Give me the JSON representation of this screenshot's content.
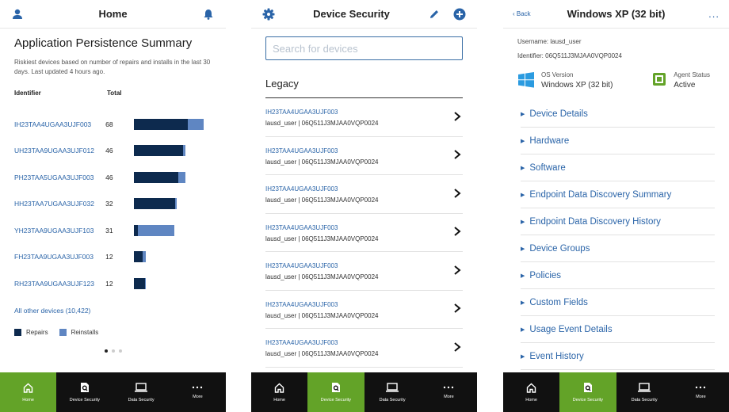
{
  "colors": {
    "accent_green": "#63a328",
    "nav_bg": "#111111",
    "link_blue": "#2a64a8",
    "repairs": "#0d2a4e",
    "reinstalls": "#5f86c2"
  },
  "nav": [
    {
      "label": "Home",
      "icon": "home-icon"
    },
    {
      "label": "Device Security",
      "icon": "device-security-icon"
    },
    {
      "label": "Data Security",
      "icon": "laptop-icon"
    },
    {
      "label": "More",
      "icon": "more-icon"
    }
  ],
  "home": {
    "title": "Home",
    "heading": "Application Persistence Summary",
    "description": "Riskiest devices based on number of repairs and installs in the last 30 days. Last updated 4 hours ago.",
    "col_identifier": "Identifier",
    "col_total": "Total",
    "rows": [
      {
        "id": "IH23TAA4UGAA3UJF003",
        "total": "68",
        "repairs": 68,
        "reinstalls": 20
      },
      {
        "id": "UH23TAA9UGAA3UJF012",
        "total": "46",
        "repairs": 62,
        "reinstalls": 3
      },
      {
        "id": "PH23TAA5UGAA3UJF003",
        "total": "46",
        "repairs": 56,
        "reinstalls": 9
      },
      {
        "id": "HH23TAA7UGAA3UJF032",
        "total": "32",
        "repairs": 52,
        "reinstalls": 2
      },
      {
        "id": "YH23TAA9UGAA3UJF103",
        "total": "31",
        "repairs": 5,
        "reinstalls": 46
      },
      {
        "id": "FH23TAA9UGAA3UJF003",
        "total": "12",
        "repairs": 11,
        "reinstalls": 4
      },
      {
        "id": "RH23TAA9UGAA3UJF123",
        "total": "12",
        "repairs": 14,
        "reinstalls": 1
      }
    ],
    "all_other": "All other devices (10,422)",
    "legend_repairs": "Repairs",
    "legend_reinstalls": "Reinstalls"
  },
  "device_security": {
    "title": "Device Security",
    "search_placeholder": "Search for devices",
    "section": "Legacy",
    "devices": [
      {
        "id": "IH23TAA4UGAA3UJF003",
        "meta": "lausd_user | 06Q511J3MJAA0VQP0024"
      },
      {
        "id": "IH23TAA4UGAA3UJF003",
        "meta": "lausd_user | 06Q511J3MJAA0VQP0024"
      },
      {
        "id": "IH23TAA4UGAA3UJF003",
        "meta": "lausd_user | 06Q511J3MJAA0VQP0024"
      },
      {
        "id": "IH23TAA4UGAA3UJF003",
        "meta": "lausd_user | 06Q511J3MJAA0VQP0024"
      },
      {
        "id": "IH23TAA4UGAA3UJF003",
        "meta": "lausd_user | 06Q511J3MJAA0VQP0024"
      },
      {
        "id": "IH23TAA4UGAA3UJF003",
        "meta": "lausd_user | 06Q511J3MJAA0VQP0024"
      },
      {
        "id": "IH23TAA4UGAA3UJF003",
        "meta": "lausd_user | 06Q511J3MJAA0VQP0024"
      }
    ]
  },
  "device_detail": {
    "back": "Back",
    "title": "Windows XP (32 bit)",
    "more": "...",
    "username": "Username: lausd_user",
    "identifier": "Identifier: 06Q511J3MJAA0VQP0024",
    "os_label": "OS Version",
    "os_value": "Windows XP (32 bit)",
    "agent_label": "Agent Status",
    "agent_value": "Active",
    "sections": [
      "Device Details",
      "Hardware",
      "Software",
      "Endpoint Data Discovery Summary",
      "Endpoint Data Discovery History",
      "Device Groups",
      "Policies",
      "Custom Fields",
      "Usage Event Details",
      "Event History"
    ]
  }
}
